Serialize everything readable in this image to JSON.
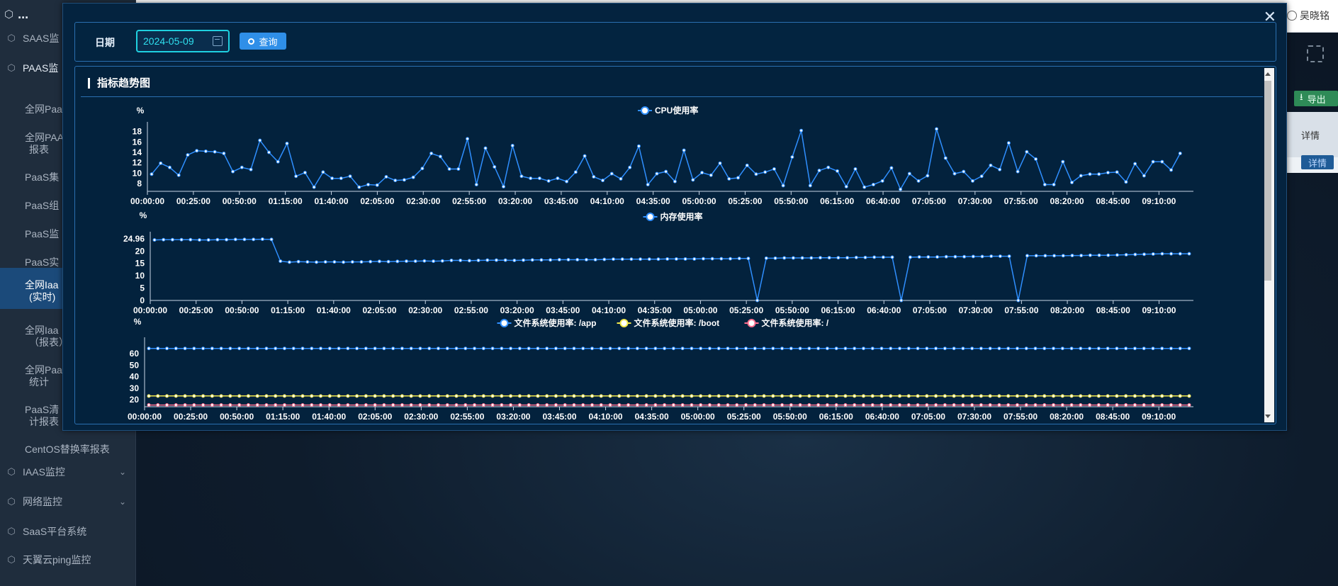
{
  "sidebar": {
    "top": "...",
    "items": [
      {
        "label": "SAAS监",
        "top": 54
      },
      {
        "label": "PAAS监",
        "top": 96
      }
    ],
    "sub": [
      {
        "label": "全网Paa",
        "lines": [
          "全网Paa"
        ]
      },
      {
        "label": "全网PAA 报表",
        "lines": [
          "全网PAA",
          "报表"
        ]
      },
      {
        "label": "PaaS集",
        "lines": [
          "PaaS集"
        ]
      },
      {
        "label": "PaaS组",
        "lines": [
          "PaaS组"
        ]
      },
      {
        "label": "PaaS监",
        "lines": [
          "PaaS监"
        ]
      },
      {
        "label": "PaaS实",
        "lines": [
          "PaaS实"
        ]
      },
      {
        "label": "全网Iaa (实时)",
        "lines": [
          "全网Iaa",
          "(实时)"
        ]
      },
      {
        "label": "全网Iaa （报表）",
        "lines": [
          "全网Iaa",
          "（报表）"
        ]
      },
      {
        "label": "全网Paa 统计",
        "lines": [
          "全网Paa",
          "统计"
        ]
      },
      {
        "label": "PaaS清 计报表",
        "lines": [
          "PaaS清",
          "计报表"
        ]
      },
      {
        "label": "CentOS替换率报表",
        "lines": [
          "CentOS替换率报表"
        ]
      }
    ],
    "bottom": [
      {
        "label": "IAAS监控",
        "chevron": true
      },
      {
        "label": "网络监控",
        "chevron": true
      },
      {
        "label": "SaaS平台系统",
        "chevron": false
      },
      {
        "label": "天翼云ping监控",
        "chevron": false
      }
    ]
  },
  "topbar": {
    "user": "吴晓铭"
  },
  "right": {
    "export": "导出",
    "detail_header": "详情",
    "detail_btn": "详情"
  },
  "modal": {
    "date_label": "日期",
    "date_value": "2024-05-09",
    "query_label": "查询",
    "panel_title": "指标趋势图"
  },
  "chart_data": [
    {
      "type": "line",
      "ylabel": "%",
      "legend": [
        "CPU使用率"
      ],
      "yticks": [
        8,
        10,
        12,
        14,
        16,
        18
      ],
      "ylim": [
        6.5,
        18.5
      ],
      "xticks": [
        "00:00:00",
        "00:25:00",
        "00:50:00",
        "01:15:00",
        "01:40:00",
        "02:05:00",
        "02:30:00",
        "02:55:00",
        "03:20:00",
        "03:45:00",
        "04:10:00",
        "04:35:00",
        "05:00:00",
        "05:25:00",
        "05:50:00",
        "06:15:00",
        "06:40:00",
        "07:05:00",
        "07:30:00",
        "07:55:00",
        "08:20:00",
        "08:45:00",
        "09:10:00"
      ],
      "series": [
        {
          "name": "CPU使用率",
          "color": "#2f8fff",
          "values": [
            9.8,
            11.9,
            11.1,
            9.6,
            13.5,
            14.3,
            14.2,
            14.1,
            13.8,
            10.3,
            11.1,
            10.7,
            16.3,
            14.0,
            12.2,
            15.7,
            9.4,
            10.1,
            7.3,
            10.2,
            9.0,
            9.0,
            9.4,
            7.3,
            7.8,
            7.7,
            9.3,
            8.6,
            8.7,
            9.2,
            10.9,
            13.8,
            13.2,
            10.8,
            10.8,
            16.6,
            7.8,
            14.8,
            11.2,
            7.4,
            15.3,
            9.4,
            9.0,
            9.0,
            8.5,
            9.0,
            8.4,
            10.2,
            13.3,
            9.3,
            8.6,
            9.9,
            8.9,
            11.1,
            15.2,
            7.8,
            9.9,
            10.3,
            8.4,
            14.4,
            8.7,
            10.1,
            9.6,
            11.9,
            8.9,
            9.1,
            11.5,
            9.8,
            10.2,
            10.8,
            7.6,
            13.1,
            18.2,
            7.6,
            10.5,
            11.1,
            10.4,
            7.4,
            10.8,
            7.3,
            7.8,
            8.5,
            11.0,
            6.9,
            9.9,
            8.5,
            9.5,
            18.5,
            12.9,
            9.9,
            10.3,
            8.5,
            9.4,
            11.5,
            10.7,
            15.8,
            10.3,
            14.1,
            12.7,
            7.8,
            7.8,
            12.2,
            8.2,
            9.5,
            9.8,
            9.8,
            10.1,
            10.2,
            8.3,
            11.8,
            9.5,
            12.2,
            12.2,
            10.6,
            13.8
          ]
        }
      ]
    },
    {
      "type": "line",
      "ylabel": "%",
      "legend": [
        "内存使用率"
      ],
      "yticks": [
        0,
        5,
        10,
        15,
        20,
        24.96
      ],
      "ylim": [
        0,
        24.96
      ],
      "xticks": [
        "00:00:00",
        "00:25:00",
        "00:50:00",
        "01:15:00",
        "01:40:00",
        "02:05:00",
        "02:30:00",
        "02:55:00",
        "03:20:00",
        "03:45:00",
        "04:10:00",
        "04:35:00",
        "05:00:00",
        "05:25:00",
        "05:50:00",
        "06:15:00",
        "06:40:00",
        "07:05:00",
        "07:30:00",
        "07:55:00",
        "08:20:00",
        "08:45:00",
        "09:10:00"
      ],
      "series": [
        {
          "name": "内存使用率",
          "color": "#2f8fff",
          "values": [
            24.5,
            24.6,
            24.6,
            24.6,
            24.6,
            24.5,
            24.5,
            24.6,
            24.6,
            24.7,
            24.7,
            24.7,
            24.8,
            24.7,
            15.9,
            15.5,
            15.7,
            15.6,
            15.5,
            15.6,
            15.6,
            15.5,
            15.6,
            15.6,
            15.7,
            15.8,
            15.7,
            15.8,
            15.9,
            15.9,
            16.0,
            15.9,
            16.0,
            16.2,
            16.2,
            16.1,
            16.2,
            16.3,
            16.3,
            16.3,
            16.2,
            16.3,
            16.4,
            16.4,
            16.4,
            16.5,
            16.5,
            16.5,
            16.5,
            16.5,
            16.6,
            16.7,
            16.7,
            16.7,
            16.7,
            16.7,
            16.7,
            16.8,
            16.8,
            16.8,
            16.8,
            16.9,
            16.9,
            16.9,
            16.9,
            17.0,
            17.0,
            0.0,
            17.1,
            17.1,
            17.2,
            17.2,
            17.2,
            17.2,
            17.3,
            17.3,
            17.3,
            17.3,
            17.4,
            17.4,
            17.5,
            17.5,
            17.5,
            0.0,
            17.5,
            17.6,
            17.6,
            17.6,
            17.7,
            17.7,
            17.7,
            17.8,
            17.8,
            17.9,
            17.9,
            17.9,
            0.0,
            18.1,
            18.1,
            18.1,
            18.1,
            18.1,
            18.2,
            18.2,
            18.3,
            18.3,
            18.3,
            18.4,
            18.5,
            18.6,
            18.7,
            18.8,
            18.9,
            18.9,
            18.9,
            18.9
          ]
        }
      ]
    },
    {
      "type": "line",
      "ylabel": "%",
      "legend": [
        "文件系统使用率: /app",
        "文件系统使用率: /boot",
        "文件系统使用率: /"
      ],
      "yticks": [
        20,
        30,
        40,
        50,
        60
      ],
      "ylim": [
        14,
        68
      ],
      "xticks": [
        "00:00:00",
        "00:25:00",
        "00:50:00",
        "01:15:00",
        "01:40:00",
        "02:05:00",
        "02:30:00",
        "02:55:00",
        "03:20:00",
        "03:45:00",
        "04:10:00",
        "04:35:00",
        "05:00:00",
        "05:25:00",
        "05:50:00",
        "06:15:00",
        "06:40:00",
        "07:05:00",
        "07:30:00",
        "07:55:00",
        "08:20:00",
        "08:45:00",
        "09:10:00"
      ],
      "series": [
        {
          "name": "文件系统使用率: /app",
          "color": "#2f8fff",
          "constant": 64.5
        },
        {
          "name": "文件系统使用率: /boot",
          "color": "#f2e84b",
          "constant": 23.3
        },
        {
          "name": "文件系统使用率: /",
          "color": "#ff6f8f",
          "constant": 15.5
        }
      ]
    }
  ]
}
